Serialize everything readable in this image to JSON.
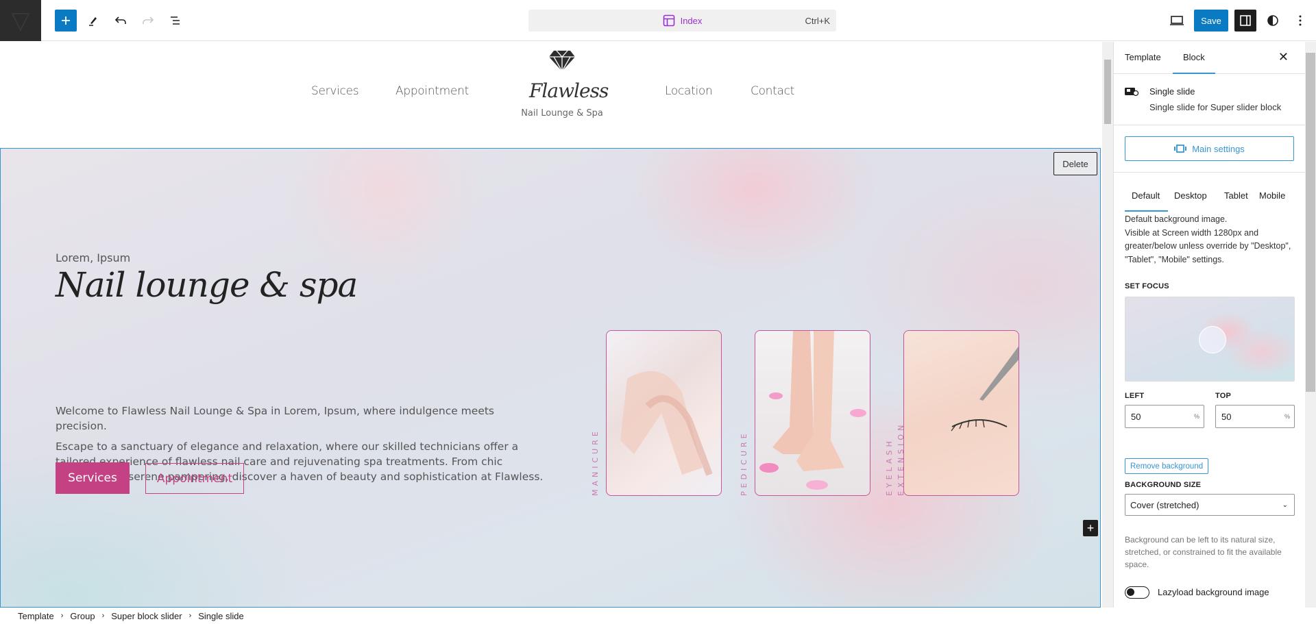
{
  "topbar": {
    "command_label": "Index",
    "command_shortcut": "Ctrl+K",
    "save_label": "Save",
    "icons": [
      "site-icon",
      "add-block-icon",
      "pencil-icon",
      "undo-icon",
      "redo-icon",
      "list-view-icon",
      "layout-icon",
      "desktop-preview-icon",
      "sidebar-icon",
      "contrast-icon",
      "more-vertical-icon"
    ]
  },
  "site_header": {
    "nav_left": [
      "Services",
      "Appointment"
    ],
    "nav_right": [
      "Location",
      "Contact"
    ],
    "logo_name": "Flawless",
    "logo_sub": "Nail Lounge & Spa"
  },
  "slide": {
    "delete_label": "Delete",
    "eyebrow": "Lorem, Ipsum",
    "title": "Nail lounge & spa",
    "intro": "Welcome to Flawless Nail Lounge & Spa in Lorem, Ipsum, where indulgence meets precision.",
    "body": "Escape to a sanctuary of elegance and relaxation, where our skilled technicians offer a tailored experience of flawless nail care and rejuvenating spa treatments. From chic manicures to serene pampering, discover a haven of beauty and sophistication at Flawless.",
    "btn_primary": "Services",
    "btn_secondary": "Appointment",
    "cards": [
      {
        "label": "MANICURE"
      },
      {
        "label": "PEDICURE"
      },
      {
        "label_line1": "EYELASH",
        "label_line2": "EXTENSION"
      }
    ]
  },
  "breadcrumbs": [
    "Template",
    "Group",
    "Super block slider",
    "Single slide"
  ],
  "panel": {
    "tabs": [
      "Template",
      "Block"
    ],
    "active_tab": "Block",
    "block_title": "Single slide",
    "block_desc": "Single slide for Super slider block",
    "main_settings": "Main settings",
    "viewport_tabs": [
      "Default",
      "Desktop",
      "Tablet",
      "Mobile"
    ],
    "active_viewport": "Default",
    "viewport_desc_1": "Default background image.",
    "viewport_desc_2": "Visible at Screen width 1280px and greater/below unless override by \"Desktop\", \"Tablet\", \"Mobile\" settings.",
    "set_focus_label": "SET FOCUS",
    "left_label": "LEFT",
    "left_value": "50",
    "top_label": "TOP",
    "top_value": "50",
    "unit": "%",
    "remove_bg": "Remove background",
    "bg_size_label": "BACKGROUND SIZE",
    "bg_size_value": "Cover (stretched)",
    "bg_help": "Background can be left to its natural size, stretched, or constrained to fit the available space.",
    "lazyload_label": "Lazyload background image",
    "lazyload_on": false
  },
  "colors": {
    "wp_blue": "#0a7bc2",
    "accent_pink": "#c44283",
    "command_purple": "#9b2fcf",
    "selection_blue": "#3895d3"
  }
}
